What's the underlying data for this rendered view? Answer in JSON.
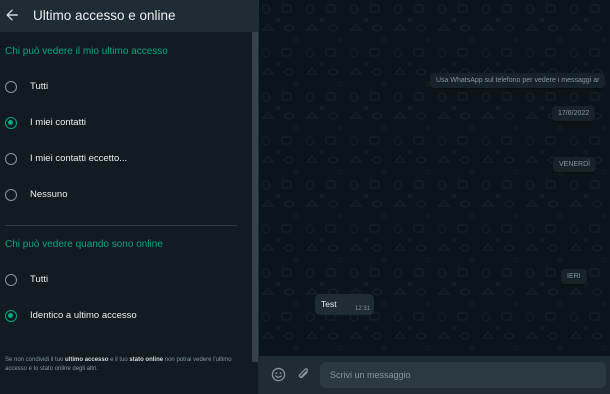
{
  "header": {
    "title": "Ultimo accesso e online"
  },
  "last_seen": {
    "title": "Chi può vedere il mio ultimo accesso",
    "options": [
      {
        "label": "Tutti",
        "checked": false
      },
      {
        "label": "I miei contatti",
        "checked": true
      },
      {
        "label": "I miei contatti eccetto...",
        "checked": false
      },
      {
        "label": "Nessuno",
        "checked": false
      }
    ]
  },
  "online": {
    "title": "Chi può vedere quando sono online",
    "options": [
      {
        "label": "Tutti",
        "checked": false
      },
      {
        "label": "Identico a ultimo accesso",
        "checked": true
      }
    ]
  },
  "footnote": {
    "p1": "Se non condividi il tuo ",
    "b1": "ultimo accesso",
    "p2": " e il tuo ",
    "b2": "stato online",
    "p3": " non potrai vedere l'ultimo accesso e lo stato online degli altri."
  },
  "chat": {
    "notice": "Usa WhatsApp sul telefono per vedere i messaggi ar",
    "date1": "17/6/2022",
    "date2": "VENERDÌ",
    "date3": "IERI",
    "message": {
      "text": "Test",
      "time": "12:31"
    }
  },
  "composer": {
    "placeholder": "Scrivi un messaggio"
  },
  "colors": {
    "accent": "#00a884",
    "panel_bg": "#111b21",
    "header_bg": "#202c33",
    "chat_bg": "#0b141a"
  },
  "icons": [
    "back-arrow-icon",
    "emoji-icon",
    "paperclip-icon"
  ]
}
